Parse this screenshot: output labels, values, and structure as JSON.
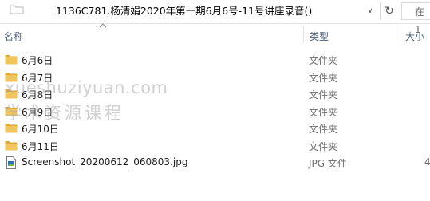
{
  "address_bar": {
    "path": "1136C781.杨清娟2020年第一期6月6号-11号讲座录音()",
    "dropdown_glyph": "∨",
    "refresh_glyph": "↻",
    "search_prefix": "在 1"
  },
  "columns": {
    "name": "名称",
    "type": "类型",
    "size": "大小"
  },
  "files": [
    {
      "name": "6月6日",
      "type": "文件夹",
      "size": "",
      "icon": "folder-icon"
    },
    {
      "name": "6月7日",
      "type": "文件夹",
      "size": "",
      "icon": "folder-icon"
    },
    {
      "name": "6月8日",
      "type": "文件夹",
      "size": "",
      "icon": "folder-icon"
    },
    {
      "name": "6月9日",
      "type": "文件夹",
      "size": "",
      "icon": "folder-icon"
    },
    {
      "name": "6月10日",
      "type": "文件夹",
      "size": "",
      "icon": "folder-icon"
    },
    {
      "name": "6月11日",
      "type": "文件夹",
      "size": "",
      "icon": "folder-icon"
    },
    {
      "name": "Screenshot_20200612_060803.jpg",
      "type": "JPG 文件",
      "size": "4",
      "icon": "image-file-icon"
    }
  ],
  "watermark": {
    "line1": "xueshuziyuan.com",
    "line2": "学术资源课程"
  },
  "colors": {
    "folder": "#f2c55c",
    "folder_dark": "#dcaa3b",
    "header_text": "#4c607a",
    "muted_text": "#6d6d6d"
  }
}
